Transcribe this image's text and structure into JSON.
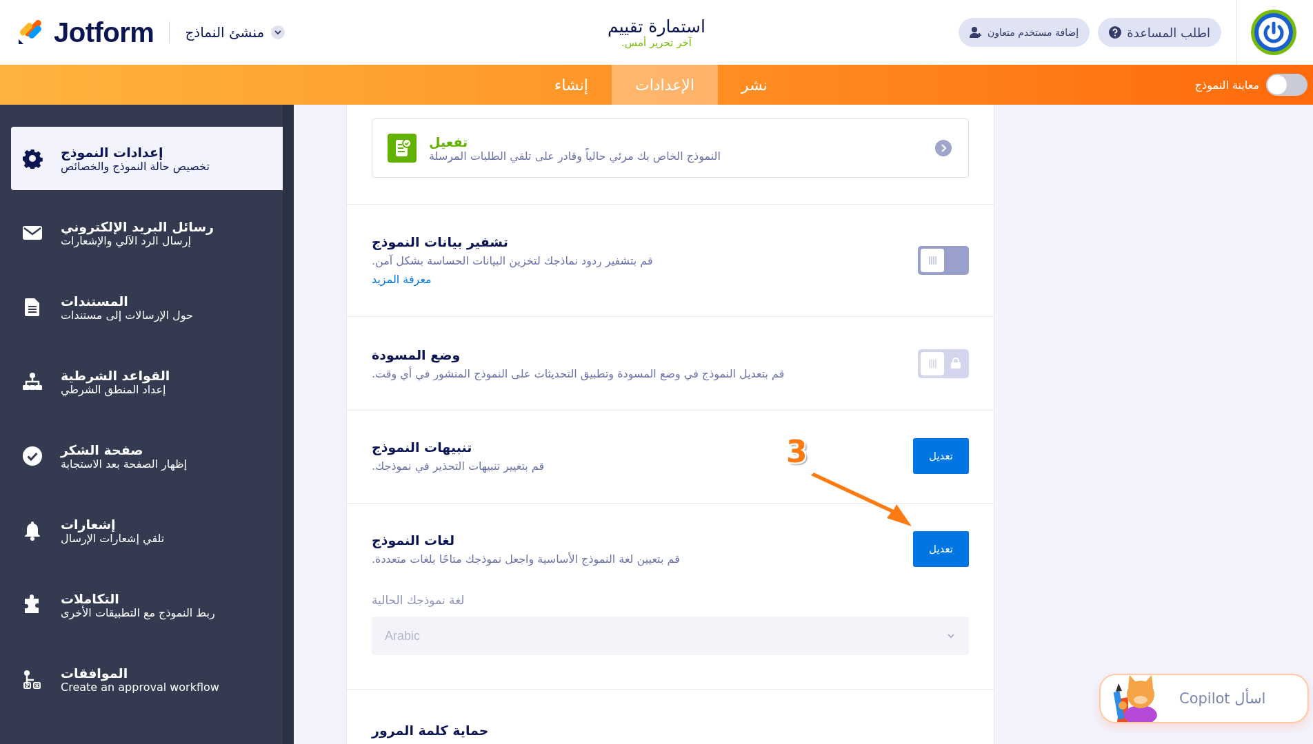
{
  "header": {
    "logo": "Jotform",
    "builder_menu": "منشئ النماذج",
    "title": "استمارة تقييم",
    "last_edited": "آخر تحرير أمس.",
    "buttons": [
      {
        "kind": "help",
        "label": "اطلب المساعدة"
      },
      {
        "kind": "invite",
        "label": "إضافة مستخدم متعاون"
      }
    ]
  },
  "nav": {
    "tabs": [
      {
        "label": "نشر",
        "selected": false
      },
      {
        "label": "الإعدادات",
        "selected": true
      },
      {
        "label": "إنشاء",
        "selected": false
      }
    ],
    "preview": {
      "label": "معاينة النموذج",
      "on": false
    }
  },
  "sidebar": {
    "items": [
      {
        "kind": "gear",
        "title": "إعدادات النموذج",
        "subtitle": "تخصيص حالة النموذج والخصائص",
        "selected": true
      },
      {
        "kind": "envelope",
        "title": "رسائل البريد الإلكتروني",
        "subtitle": "إرسال الرد الآلي والإشعارات",
        "selected": false
      },
      {
        "kind": "document",
        "title": "المستندات",
        "subtitle": "حول الإرسالات إلى مستندات",
        "selected": false
      },
      {
        "kind": "tree",
        "title": "القواعد الشرطية",
        "subtitle": "إعداد المنطق الشرطي",
        "selected": false
      },
      {
        "kind": "check",
        "title": "صفحة الشكر",
        "subtitle": "إظهار الصفحة بعد الاستجابة",
        "selected": false
      },
      {
        "kind": "bell",
        "title": "إشعارات",
        "subtitle": "تلقي إشعارات الإرسال",
        "selected": false
      },
      {
        "kind": "puzzle",
        "title": "التكاملات",
        "subtitle": "ربط النموذج مع التطبيقات الأخرى",
        "selected": false
      },
      {
        "kind": "workflow",
        "title": "الموافقات",
        "subtitle": "Create an approval workflow",
        "selected": false
      }
    ]
  },
  "status_box": {
    "title": "تفعيل",
    "description": "النموذج الخاص بك مرئي حالياً وقادر على تلقي الطلبات المرسلة"
  },
  "settings": [
    {
      "kind": "toggle",
      "title": "تشفير بيانات النموذج",
      "description": "قم بتشفير ردود نماذجك لتخزين البيانات الحساسة بشكل آمن.",
      "link": "معرفة المزيد",
      "on": false,
      "disabled": false
    },
    {
      "kind": "toggle",
      "title": "وضع المسودة",
      "description": "قم بتعديل النموذج في وضع المسودة وتطبيق التحديثات على النموذج المنشور في أي وقت.",
      "on": false,
      "disabled": true
    },
    {
      "kind": "button",
      "title": "تنبيهات النموذج",
      "description": "قم بتغيير تنبيهات التحذير في نموذجك.",
      "button": "تعديل"
    },
    {
      "kind": "button",
      "title": "لغات النموذج",
      "description": "قم بتعيين لغة النموذج الأساسية واجعل نموذجك متاحًا بلغات متعددة.",
      "button": "تعديل",
      "field": {
        "label": "لغة نموذجك الحالية",
        "value": "Arabic",
        "disabled": true
      }
    },
    {
      "kind": "heading",
      "title": "حماية كلمة المرور"
    }
  ],
  "annotation": {
    "label": "3"
  },
  "copilot": {
    "label": "اسأل Copilot"
  }
}
